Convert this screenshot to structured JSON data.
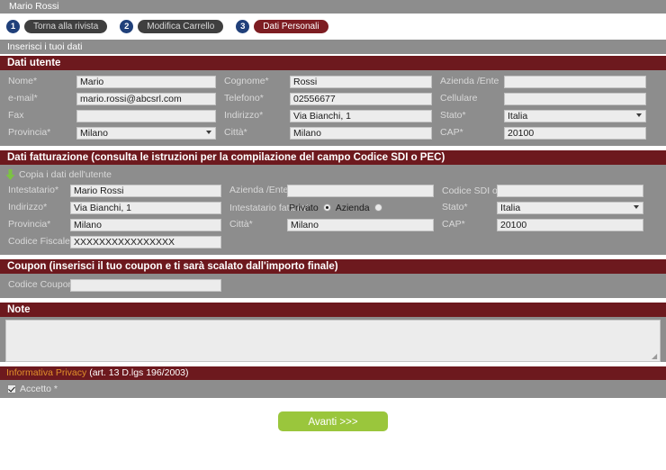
{
  "user_bar": {
    "name": "Mario Rossi"
  },
  "steps": [
    {
      "num": "1",
      "label": "Torna alla rivista",
      "active": false
    },
    {
      "num": "2",
      "label": "Modifica Carrello",
      "active": false
    },
    {
      "num": "3",
      "label": "Dati Personali",
      "active": true
    }
  ],
  "subbar": {
    "text": "Inserisci i tuoi dati"
  },
  "sections": {
    "user_data": {
      "title": "Dati utente",
      "fields": {
        "nome_label": "Nome*",
        "nome_value": "Mario",
        "cognome_label": "Cognome*",
        "cognome_value": "Rossi",
        "azienda_label": "Azienda /Ente",
        "azienda_value": "",
        "email_label": "e-mail*",
        "email_value": "mario.rossi@abcsrl.com",
        "telefono_label": "Telefono*",
        "telefono_value": "02556677",
        "cellulare_label": "Cellulare",
        "cellulare_value": "",
        "fax_label": "Fax",
        "fax_value": "",
        "indirizzo_label": "Indirizzo*",
        "indirizzo_value": "Via Bianchi, 1",
        "stato_label": "Stato*",
        "stato_value": "Italia",
        "provincia_label": "Provincia*",
        "provincia_value": "Milano",
        "citta_label": "Città*",
        "citta_value": "Milano",
        "cap_label": "CAP*",
        "cap_value": "20100"
      }
    },
    "billing_data": {
      "title": "Dati fatturazione (consulta le istruzioni per la compilazione del campo Codice SDI o PEC)",
      "copy_link": "Copia i dati dell'utente",
      "copy_icon": "green-down-arrow-icon",
      "fields": {
        "intestatario_label": "Intestatario*",
        "intestatario_value": "Mario Rossi",
        "azienda_label": "Azienda /Ente",
        "azienda_value": "",
        "sdi_label": "Codice SDI o PEC",
        "sdi_value": "",
        "indirizzo_label": "Indirizzo*",
        "indirizzo_value": "Via Bianchi, 1",
        "intestatario_fattura_label": "Intestatario fattura*",
        "radio_privato": "Privato",
        "radio_azienda": "Azienda",
        "radio_selected": "Privato",
        "stato_label": "Stato*",
        "stato_value": "Italia",
        "provincia_label": "Provincia*",
        "provincia_value": "Milano",
        "citta_label": "Città*",
        "citta_value": "Milano",
        "cap_label": "CAP*",
        "cap_value": "20100",
        "codice_fiscale_label": "Codice Fiscale**",
        "codice_fiscale_value": "XXXXXXXXXXXXXXXX"
      }
    },
    "coupon": {
      "title": "Coupon (inserisci il tuo coupon e ti sarà scalato dall'importo finale)",
      "code_label": "Codice Coupon",
      "code_value": "",
      "code_placeholder": ""
    },
    "note": {
      "title": "Note",
      "value": "",
      "placeholder": ""
    },
    "privacy": {
      "link_text": "Informativa Privacy",
      "rest_text": " (art. 13 D.lgs 196/2003)",
      "accept_label": "Accetto *",
      "accepted": true
    }
  },
  "submit": {
    "label": "Avanti >>>"
  },
  "colors": {
    "panel_header": "#6d191e",
    "panel_body": "#8d8d8d",
    "step_num": "#20407a",
    "step_pill": "#3f3f3f",
    "step_active": "#7d1d22",
    "submit": "#9ac63c",
    "privacy_link": "#e0902a",
    "field_bg": "#ececec"
  }
}
